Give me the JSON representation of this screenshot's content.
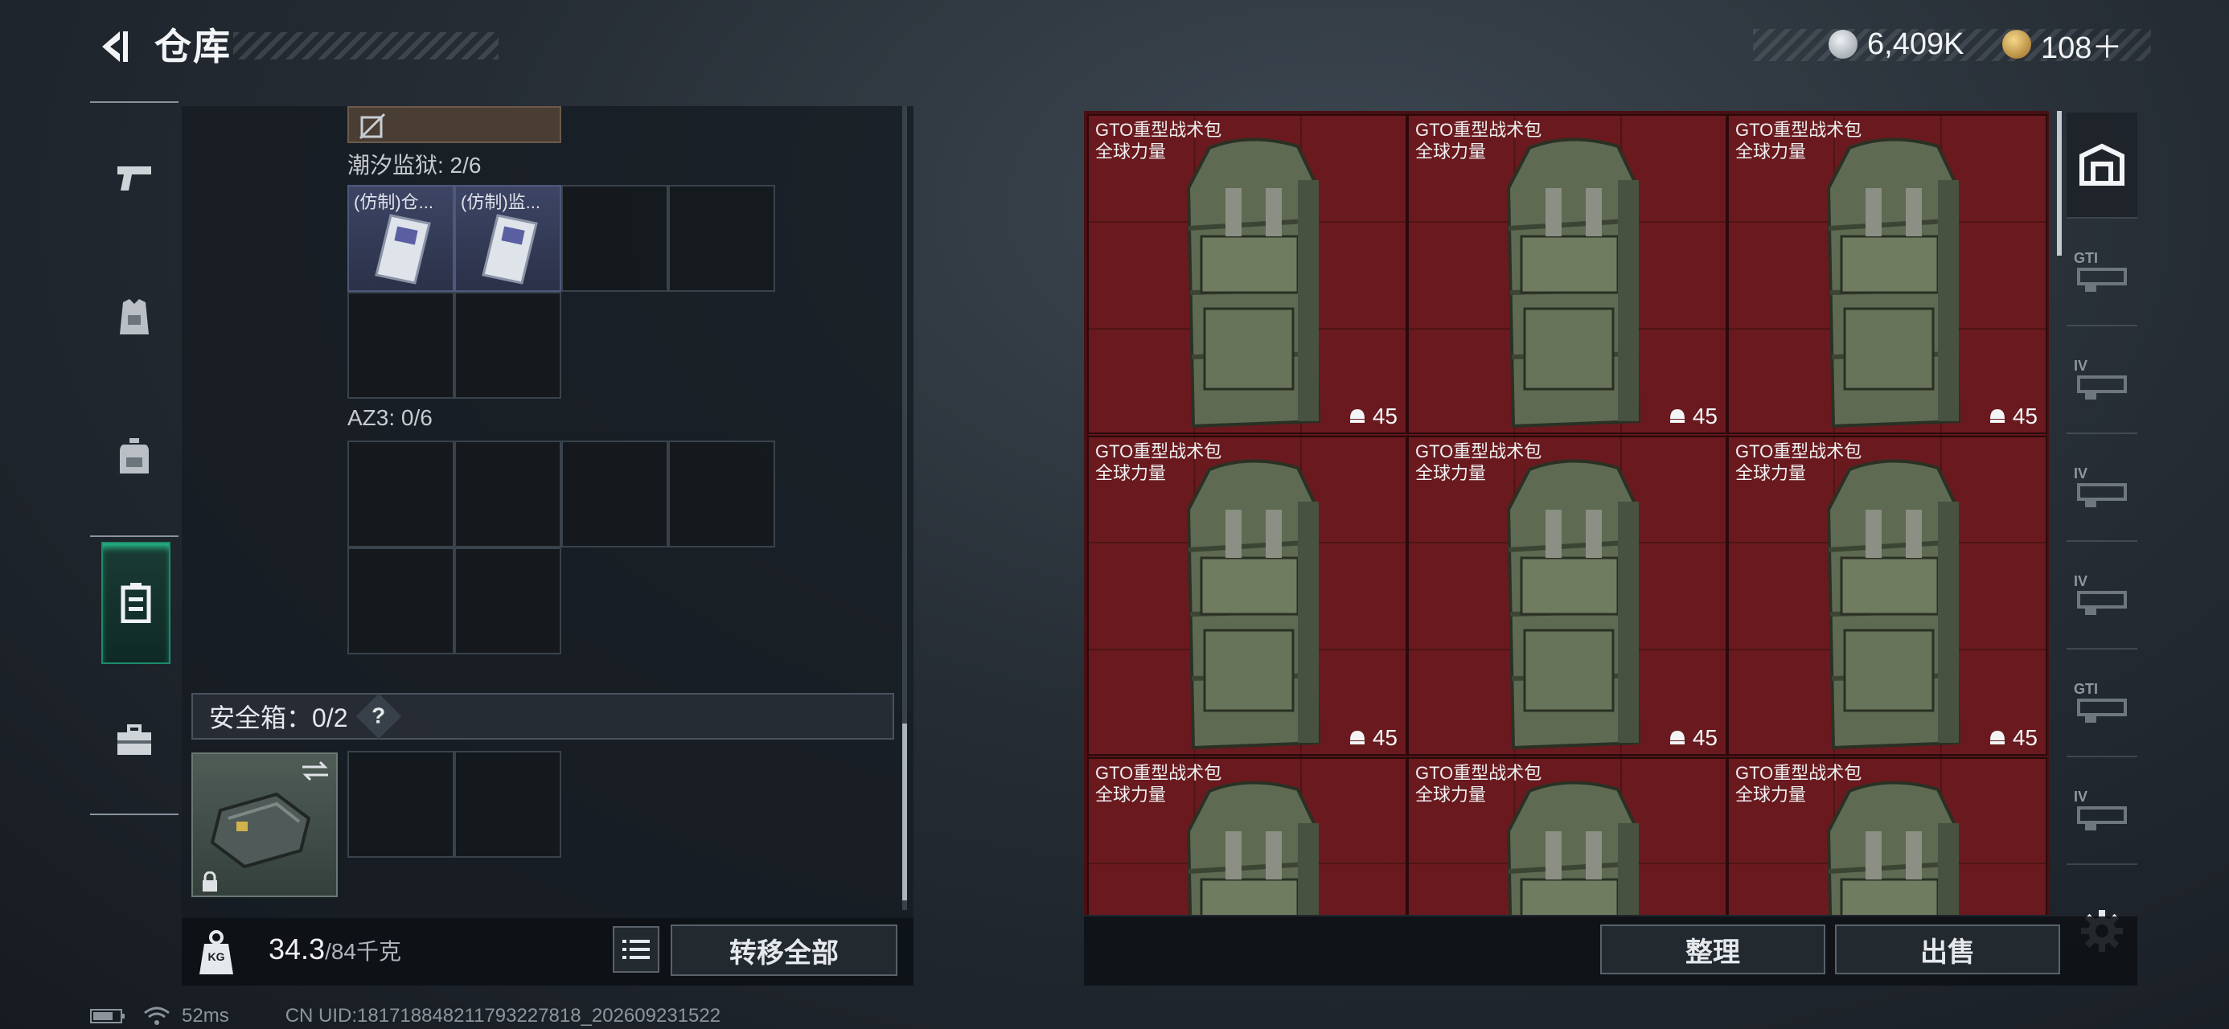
{
  "header": {
    "title": "仓库"
  },
  "currency": [
    {
      "name": "silver-coin-icon",
      "value": "6,409K",
      "color": "#b5bcc4"
    },
    {
      "name": "gold-coin-icon",
      "value": "108＋",
      "color": "#c79a3a"
    }
  ],
  "sidenav": [
    {
      "icon": "pistol-icon"
    },
    {
      "icon": "vest-icon"
    },
    {
      "icon": "backpack-icon"
    },
    {
      "icon": "clipboard-icon",
      "active": true
    },
    {
      "icon": "toolbox-icon"
    }
  ],
  "containers": [
    {
      "label": "潮汐监狱: 2/6",
      "items": [
        {
          "name": "(仿制)仓..."
        },
        {
          "name": "(仿制)监..."
        }
      ]
    },
    {
      "label": "AZ3: 0/6",
      "items": []
    }
  ],
  "safe_box": {
    "label": "安全箱：0/2",
    "help": "?"
  },
  "bottom_left": {
    "weight": "34.3",
    "capacity": "/84千克",
    "kg_label": "KG",
    "transfer_label": "转移全部"
  },
  "storage": {
    "item_name": "GTO重型战术包",
    "item_subtitle": "全球力量",
    "capacity": "45",
    "count": 9
  },
  "right_tabs": [
    {
      "label": "",
      "icon": "warehouse-icon",
      "active": true
    },
    {
      "label": "GTI",
      "icon": "rifle-case-icon"
    },
    {
      "label": "IV",
      "icon": "rifle-case-icon"
    },
    {
      "label": "IV",
      "icon": "rifle-case-icon"
    },
    {
      "label": "IV",
      "icon": "file-case-icon"
    },
    {
      "label": "GTI",
      "icon": "case-icon"
    },
    {
      "label": "IV",
      "icon": "case-icon"
    }
  ],
  "bottom_right": {
    "sort_label": "整理",
    "sell_label": "出售"
  },
  "status": {
    "ping": "52ms",
    "uid": "CN UID:181718848211793227818_202609231522"
  }
}
